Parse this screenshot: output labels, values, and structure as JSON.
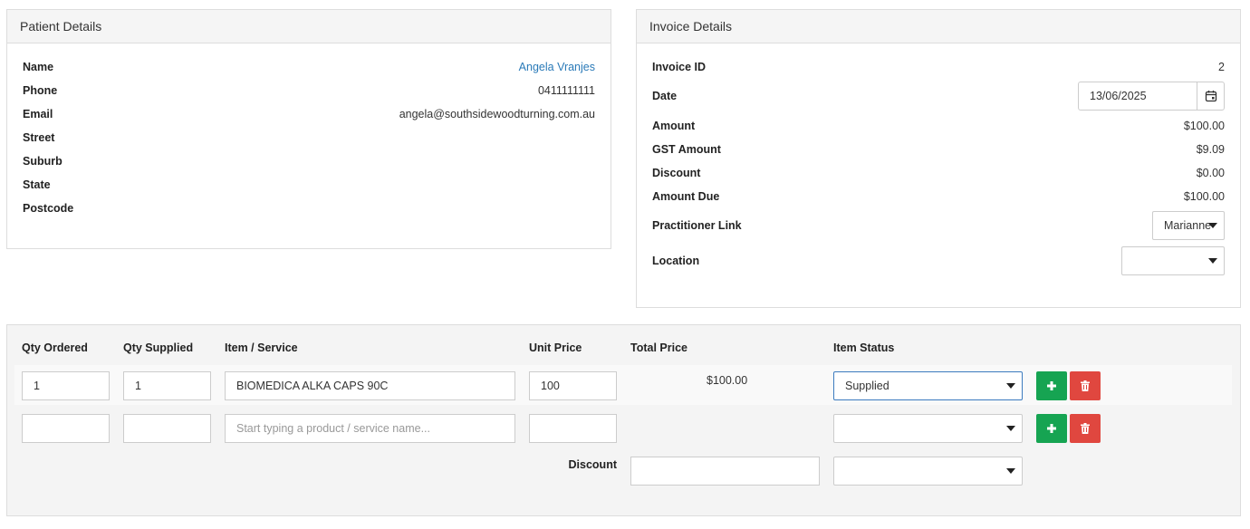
{
  "patient": {
    "title": "Patient Details",
    "fields": [
      {
        "label": "Name",
        "value": "Angela Vranjes"
      },
      {
        "label": "Phone",
        "value": "0411111111"
      },
      {
        "label": "Email",
        "value": "angela@southsidewoodturning.com.au"
      },
      {
        "label": "Street",
        "value": ""
      },
      {
        "label": "Suburb",
        "value": ""
      },
      {
        "label": "State",
        "value": ""
      },
      {
        "label": "Postcode",
        "value": ""
      }
    ]
  },
  "invoice": {
    "title": "Invoice Details",
    "invoice_id_label": "Invoice ID",
    "invoice_id": "2",
    "date_label": "Date",
    "date": "13/06/2025",
    "amount_label": "Amount",
    "amount": "$100.00",
    "gst_label": "GST Amount",
    "gst": "$9.09",
    "discount_label": "Discount",
    "discount": "$0.00",
    "amount_due_label": "Amount Due",
    "amount_due": "$100.00",
    "practitioner_label": "Practitioner Link",
    "practitioner": "Marianne",
    "location_label": "Location",
    "location": ""
  },
  "items": {
    "headers": {
      "qty_ordered": "Qty Ordered",
      "qty_supplied": "Qty Supplied",
      "item_service": "Item / Service",
      "unit_price": "Unit Price",
      "total_price": "Total Price",
      "item_status": "Item Status"
    },
    "rows": [
      {
        "qty_ordered": "1",
        "qty_supplied": "1",
        "item": "BIOMEDICA ALKA CAPS 90C",
        "unit_price": "100",
        "total_price": "$100.00",
        "status": "Supplied"
      }
    ],
    "new_row": {
      "item_placeholder": "Start typing a product / service name...",
      "status": ""
    },
    "discount_label": "Discount",
    "discount_value": "",
    "discount_type": ""
  },
  "icons": {
    "calendar": "calendar-icon",
    "add": "plus-icon",
    "delete": "trash-icon",
    "dropdown": "caret-down-icon"
  },
  "colors": {
    "link": "#2a7ab8",
    "add_button": "#16a452",
    "delete_button": "#e0473f",
    "panel_header": "#f5f5f5",
    "focus_border": "#3c7bbf"
  }
}
